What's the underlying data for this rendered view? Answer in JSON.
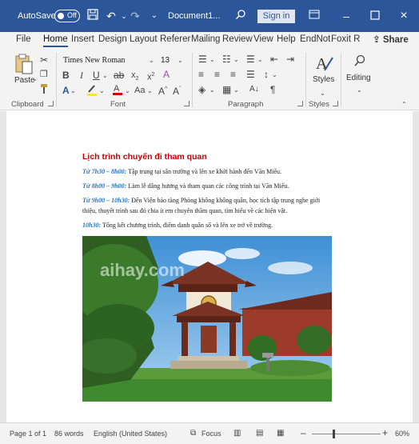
{
  "titlebar": {
    "autosave_label": "AutoSave",
    "autosave_state": "Off",
    "document_title": "Document1...",
    "sign_in_label": "Sign in",
    "icons": [
      "save-icon",
      "undo-icon",
      "redo-icon",
      "search-icon",
      "minimize-icon",
      "maximize-icon",
      "close-icon"
    ]
  },
  "tabs": {
    "file": "File",
    "home": "Home",
    "insert": "Insert",
    "design": "Design",
    "layout": "Layout",
    "references": "Referer",
    "mailings": "Mailing",
    "review": "Review",
    "view": "View",
    "help": "Help",
    "endnote": "EndNot",
    "foxit": "Foxit R",
    "share": "Share"
  },
  "ribbon": {
    "paste_label": "Paste",
    "font_name": "Times New Roman",
    "font_size": "13",
    "styles_label": "Styles",
    "editing_label": "Editing",
    "groups": {
      "clipboard": "Clipboard",
      "font": "Font",
      "paragraph": "Paragraph",
      "styles": "Styles"
    },
    "accent_color": "#2b579a"
  },
  "document": {
    "heading": "Lịch trình chuyến đi tham quan",
    "lines": [
      {
        "time": "Từ 7h30 – 8h00:",
        "text": " Tập trung tại sân trường và lên xe khởi hành đến Văn Miếu."
      },
      {
        "time": "Từ 8h00 – 9h00:",
        "text": " Làm lễ dâng hương và tham quan các công trình tại Văn Miếu."
      },
      {
        "time": "Từ 9h00 – 10h30:",
        "text": " Đến Viện bảo tàng Phòng không không quân, học tích tập trung nghe giới"
      },
      {
        "time": "",
        "text": "thiệu, thuyết trình sau đó chia ít em chuyên thăm quan, tìm hiểu về các hiện vật."
      },
      {
        "time": "10h30:",
        "text": " Tổng kết chương trình, điểm danh quân số và lên xe trở về trường."
      }
    ],
    "watermark": "aihay.com",
    "heading_color": "#c00000",
    "time_color": "#2e74b5"
  },
  "statusbar": {
    "page": "Page 1 of 1",
    "words": "86 words",
    "language": "English (United States)",
    "focus": "Focus",
    "zoom": "60%"
  }
}
